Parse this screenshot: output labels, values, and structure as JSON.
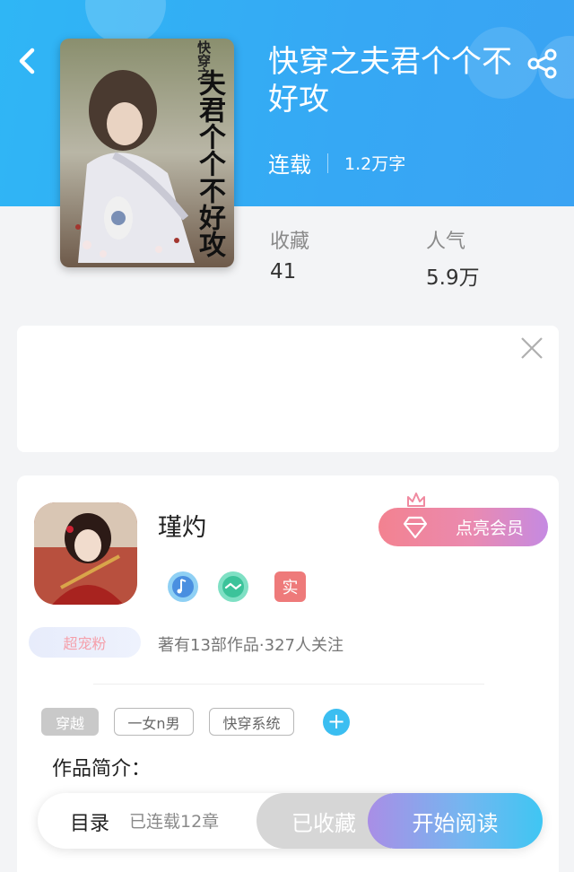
{
  "book": {
    "title": "快穿之夫君个个不好攻",
    "status": "连载",
    "word_count": "1.2万字",
    "cover_title": "夫君个个不好攻",
    "cover_series": "快穿之"
  },
  "stats": {
    "favorites_label": "收藏",
    "favorites_value": "41",
    "popularity_label": "人气",
    "popularity_value": "5.9万"
  },
  "author": {
    "name": "瑾灼",
    "vip_label": "点亮会员",
    "verified_badge": "实",
    "fan_badge": "超宠粉",
    "summary": "著有13部作品·327人关注"
  },
  "tags": [
    "穿越",
    "一女n男",
    "快穿系统"
  ],
  "tag_add_symbol": "+",
  "intro_title": "作品简介：",
  "bottom_bar": {
    "toc_label": "目录",
    "chapters": "已连载12章",
    "favorited_label": "已收藏",
    "read_label": "开始阅读"
  },
  "colors": {
    "header_blue": "#36a8f4",
    "accent_cyan": "#3bbef1",
    "vip_pink": "#f38290",
    "vip_purple": "#c58ae2"
  },
  "icons": [
    "back-arrow-icon",
    "share-icon",
    "close-icon",
    "diamond-icon",
    "crown-icon",
    "music-badge-icon",
    "handshake-badge-icon",
    "plus-icon"
  ]
}
